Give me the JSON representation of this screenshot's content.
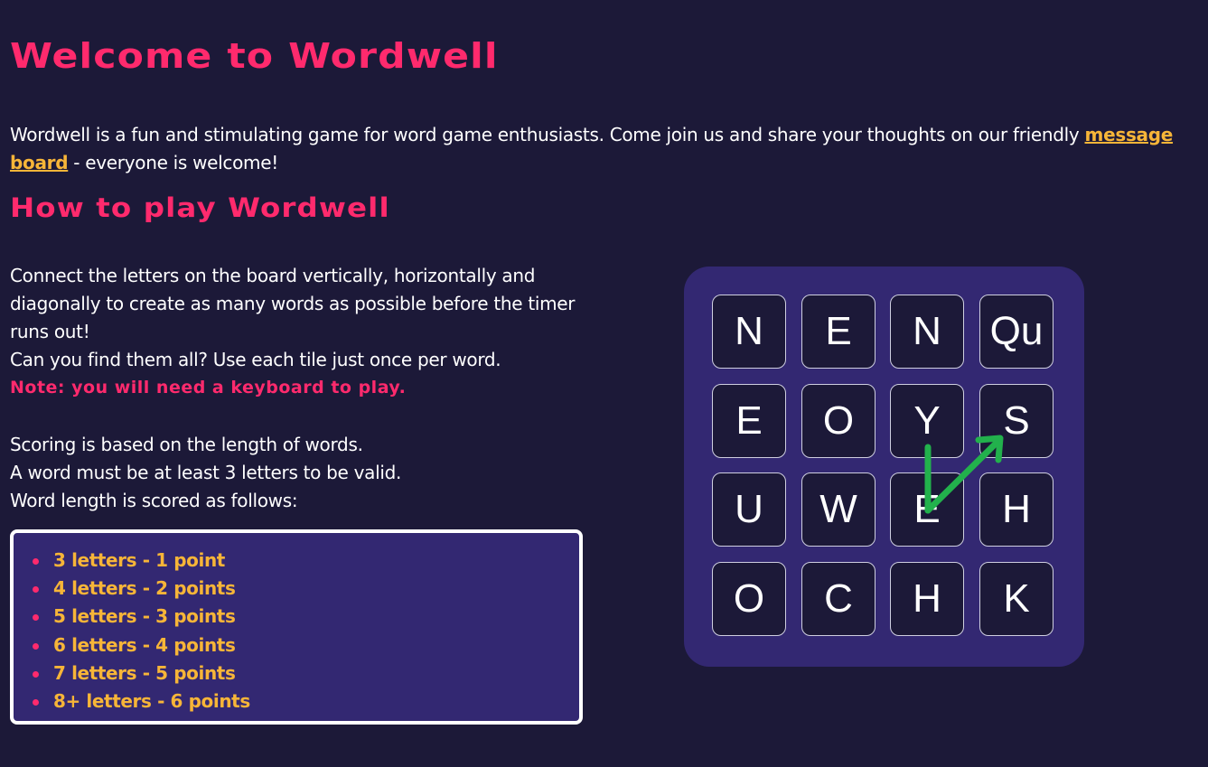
{
  "header": {
    "title": "Welcome to Wordwell"
  },
  "intro": {
    "text_before": "Wordwell is a fun and stimulating game for word game enthusiasts. Come join us and share your thoughts on our friendly ",
    "link_text": "message board",
    "text_after": " - everyone is welcome!"
  },
  "how_to": {
    "title": "How to play Wordwell",
    "line1": "Connect the letters on the board vertically, horizontally and diagonally to create as many words as possible before the timer runs out!",
    "line2": "Can you find them all? Use each tile just once per word.",
    "note": "Note: you will need a keyboard to play.",
    "scoring1": "Scoring is based on the length of words.",
    "scoring2": "A word must be at least 3 letters to be valid.",
    "scoring3": "Word length is scored as follows:"
  },
  "scoring": {
    "items": [
      "3 letters - 1 point",
      "4 letters - 2 points",
      "5 letters - 3 points",
      "6 letters - 4 points",
      "7 letters - 5 points",
      "8+ letters - 6 points"
    ]
  },
  "board": {
    "tiles": [
      [
        "N",
        "E",
        "N",
        "Qu"
      ],
      [
        "E",
        "O",
        "Y",
        "S"
      ],
      [
        "U",
        "W",
        "E",
        "H"
      ],
      [
        "O",
        "C",
        "H",
        "K"
      ]
    ],
    "trail_color": "#22b14c"
  },
  "colors": {
    "background": "#1c1938",
    "accent_pink": "#ff2a6d",
    "accent_gold": "#f7b538",
    "panel_purple": "#332872"
  }
}
